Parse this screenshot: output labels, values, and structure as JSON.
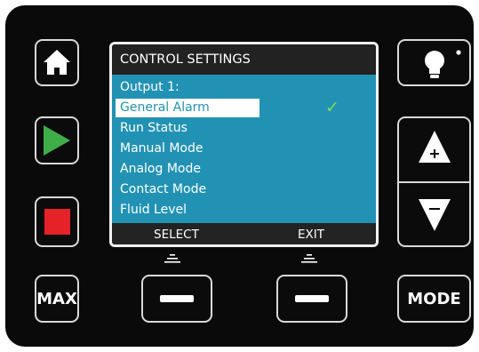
{
  "screen": {
    "title": "CONTROL SETTINGS",
    "items": [
      {
        "label": "Output 1:"
      },
      {
        "label": "General Alarm"
      },
      {
        "label": "Run Status"
      },
      {
        "label": "Manual Mode"
      },
      {
        "label": "Analog Mode"
      },
      {
        "label": "Contact Mode"
      },
      {
        "label": "Fluid Level"
      }
    ],
    "selected_index": 1,
    "check_glyph": "✓",
    "softkeys": {
      "left": "SELECT",
      "right": "EXIT"
    }
  },
  "buttons": {
    "max_label": "MAX",
    "mode_label": "MODE"
  },
  "icons": {
    "home": "home-icon",
    "play": "play-icon",
    "stop": "stop-icon",
    "light": "lightbulb-icon",
    "up": "arrow-up-plus-icon",
    "down": "arrow-down-minus-icon"
  },
  "colors": {
    "screen_bg": "#2292b4",
    "play": "#3fae49",
    "stop": "#e42228",
    "check": "#7ed957"
  }
}
